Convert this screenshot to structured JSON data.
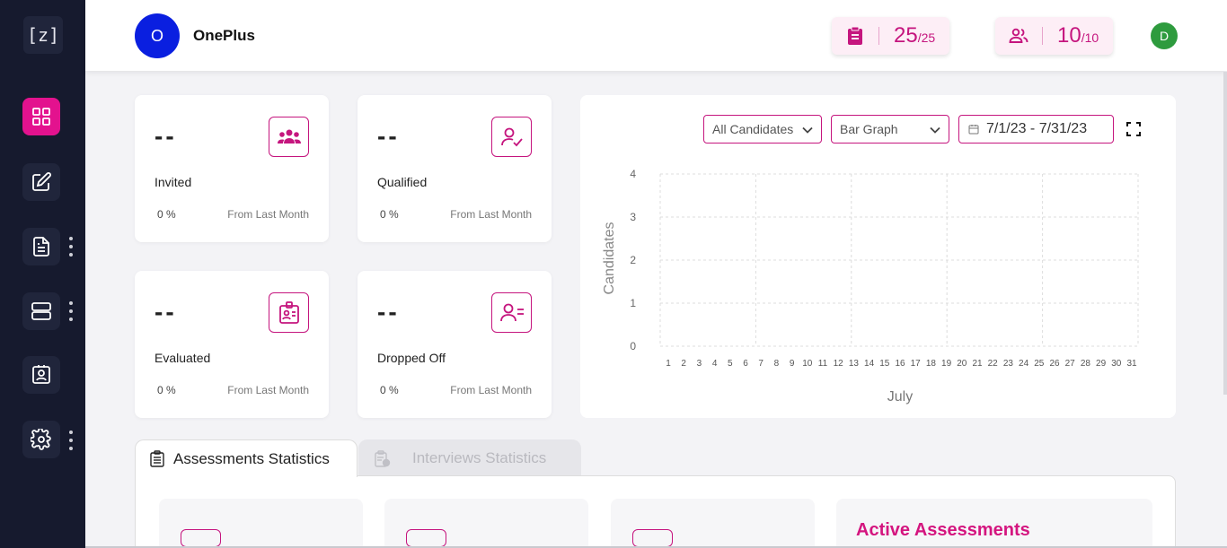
{
  "sidebar": {
    "logo_text": "[z]",
    "items": [
      {
        "icon": "dashboard-grid-icon",
        "active": true,
        "has_more": false
      },
      {
        "icon": "edit-icon",
        "active": false,
        "has_more": false
      },
      {
        "icon": "document-icon",
        "active": false,
        "has_more": true
      },
      {
        "icon": "server-icon",
        "active": false,
        "has_more": true
      },
      {
        "icon": "id-frame-icon",
        "active": false,
        "has_more": false
      },
      {
        "icon": "settings-gear-icon",
        "active": false,
        "has_more": true
      }
    ]
  },
  "header": {
    "org_initial": "O",
    "org_name": "OnePlus",
    "assessments_quota": {
      "icon": "clipboard-icon",
      "used": "25",
      "total": "/25"
    },
    "users_quota": {
      "icon": "users-icon",
      "used": "10",
      "total": "/10"
    },
    "user_initial": "D"
  },
  "stats": [
    {
      "value": "--",
      "label": "Invited",
      "percent": "0 %",
      "sub": "From Last Month",
      "icon": "group-icon"
    },
    {
      "value": "--",
      "label": "Qualified",
      "percent": "0 %",
      "sub": "From Last Month",
      "icon": "user-check-icon"
    },
    {
      "value": "--",
      "label": "Evaluated",
      "percent": "0 %",
      "sub": "From Last Month",
      "icon": "id-badge-icon"
    },
    {
      "value": "--",
      "label": "Dropped Off",
      "percent": "0 %",
      "sub": "From Last Month",
      "icon": "user-minus-icon"
    }
  ],
  "chart_controls": {
    "candidate_filter": "All Candidates",
    "graph_type": "Bar Graph",
    "date_range": "7/1/23 - 7/31/23"
  },
  "chart_data": {
    "type": "bar",
    "title": "",
    "xlabel": "July",
    "ylabel": "Candidates",
    "categories": [
      "1",
      "2",
      "3",
      "4",
      "5",
      "6",
      "7",
      "8",
      "9",
      "10",
      "11",
      "12",
      "13",
      "14",
      "15",
      "16",
      "17",
      "18",
      "19",
      "20",
      "21",
      "22",
      "23",
      "24",
      "25",
      "26",
      "27",
      "28",
      "29",
      "30",
      "31"
    ],
    "values": [
      0,
      0,
      0,
      0,
      0,
      0,
      0,
      0,
      0,
      0,
      0,
      0,
      0,
      0,
      0,
      0,
      0,
      0,
      0,
      0,
      0,
      0,
      0,
      0,
      0,
      0,
      0,
      0,
      0,
      0,
      0
    ],
    "ylim": [
      0,
      4
    ],
    "yticks": [
      "0",
      "1",
      "2",
      "3",
      "4"
    ],
    "grid": true,
    "colors": {
      "bar": "#e3128e",
      "grid": "#dcdcdc"
    }
  },
  "tabs": {
    "assessments_label": "Assessments Statistics",
    "interviews_label": "Interviews Statistics"
  },
  "assessment_panel": {
    "active_title": "Active Assessments"
  },
  "colors": {
    "accent": "#e3128e",
    "sidebar_bg": "#161a2e",
    "org_avatar": "#0a1fe0",
    "user_avatar": "#2e9b3e"
  }
}
